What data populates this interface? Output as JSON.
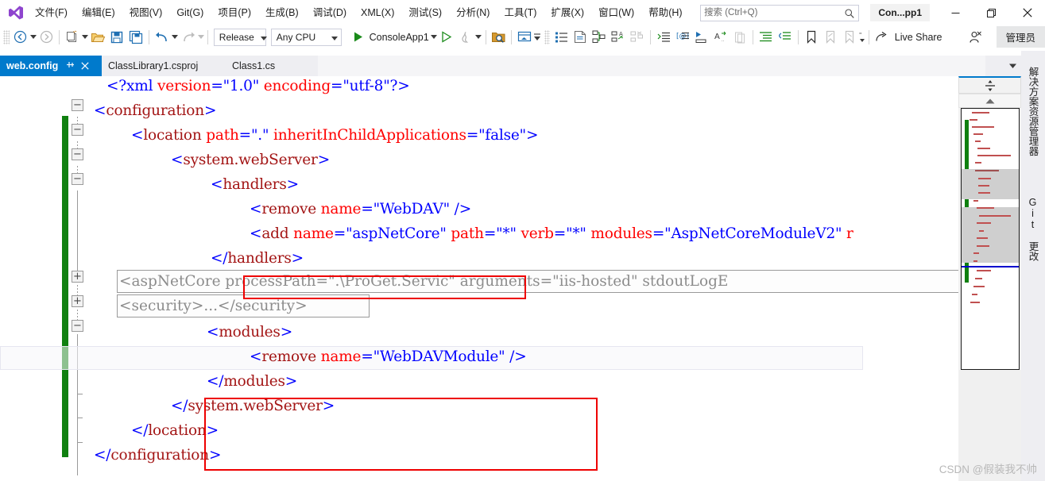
{
  "window": {
    "account_chip": "Con...pp1",
    "minimize": "─",
    "maximize": "❐",
    "close": "✕"
  },
  "menubar": {
    "logo": "vs-logo-icon",
    "items": [
      "文件(F)",
      "编辑(E)",
      "视图(V)",
      "Git(G)",
      "项目(P)",
      "生成(B)",
      "调试(D)",
      "XML(X)",
      "测试(S)",
      "分析(N)",
      "工具(T)",
      "扩展(X)",
      "窗口(W)",
      "帮助(H)"
    ]
  },
  "search": {
    "label": "搜索",
    "placeholder": "搜索 (Ctrl+Q)",
    "hint": " (Ctrl+Q)"
  },
  "toolbar": {
    "configuration": "Release",
    "platform": "Any CPU",
    "run_target": "ConsoleApp1",
    "live_share": "Live Share",
    "admin_badge": "管理员",
    "icons": [
      "navigate-back-icon",
      "navigate-forward-icon",
      "new-project-icon",
      "open-file-icon",
      "save-icon",
      "save-all-icon",
      "undo-icon",
      "redo-icon",
      "start-debug-icon",
      "start-without-debug-icon",
      "hot-reload-icon",
      "find-in-files-icon",
      "solution-explorer-icon",
      "properties-window-icon",
      "object-browser-icon",
      "class-view-icon",
      "code-definition-icon",
      "toolbox-icon",
      "indent-icon",
      "outdent-icon",
      "comment-icon",
      "uncomment-icon",
      "bookmark-icon",
      "prev-bookmark-icon",
      "next-bookmark-icon",
      "live-share-icon",
      "feedback-icon"
    ]
  },
  "tabs": {
    "items": [
      {
        "label": "web.config",
        "active": true,
        "pinned": true,
        "closable": true
      },
      {
        "label": "ClassLibrary1.csproj",
        "active": false,
        "pinned": false,
        "closable": false
      },
      {
        "label": "Class1.cs",
        "active": false,
        "pinned": false,
        "closable": false
      }
    ],
    "overflow_icon": "chevron-down-icon",
    "settings_icon": "gear-icon"
  },
  "editor": {
    "language": "xml",
    "current_line_text": "            <remove name=\"WebDAVModule\" />",
    "lines": [
      {
        "indent": 2,
        "text": "<?xml version=\"1.0\" encoding=\"utf-8\"?>"
      },
      {
        "indent": 0,
        "text": "<configuration>"
      },
      {
        "indent": 2,
        "text": "<location path=\".\" inheritInChildApplications=\"false\">"
      },
      {
        "indent": 4,
        "text": "<system.webServer>"
      },
      {
        "indent": 6,
        "text": "<handlers>"
      },
      {
        "indent": 8,
        "text": "<remove name=\"WebDAV\" />"
      },
      {
        "indent": 8,
        "text": "<add name=\"aspNetCore\" path=\"*\" verb=\"*\" modules=\"AspNetCoreModuleV2\" r"
      },
      {
        "indent": 6,
        "text": "</handlers>"
      },
      {
        "indent": 6,
        "collapsed": true,
        "text": "<aspNetCore processPath=\".\\ProGet.Servic\" arguments=\"iis-hosted\" stdoutLogE"
      },
      {
        "indent": 6,
        "collapsed": true,
        "text": "<security>...</security>"
      },
      {
        "indent": 6,
        "text": "<modules>"
      },
      {
        "indent": 8,
        "text": "<remove name=\"WebDAVModule\" />"
      },
      {
        "indent": 6,
        "text": "</modules>"
      },
      {
        "indent": 4,
        "text": "</system.webServer>"
      },
      {
        "indent": 2,
        "text": "</location>"
      },
      {
        "indent": 0,
        "text": "</configuration>"
      }
    ],
    "fold_glyphs": [
      {
        "line": 1,
        "state": "expanded",
        "symbol": "−"
      },
      {
        "line": 2,
        "state": "expanded",
        "symbol": "−"
      },
      {
        "line": 3,
        "state": "expanded",
        "symbol": "−"
      },
      {
        "line": 4,
        "state": "expanded",
        "symbol": "−"
      },
      {
        "line": 8,
        "state": "collapsed",
        "symbol": "+"
      },
      {
        "line": 9,
        "state": "collapsed",
        "symbol": "+"
      },
      {
        "line": 10,
        "state": "expanded",
        "symbol": "−"
      }
    ],
    "highlight_boxes": [
      {
        "name": "remove-webdav-highlight",
        "color": "#ee0000"
      },
      {
        "name": "modules-block-highlight",
        "color": "#ee0000"
      }
    ],
    "change_bar_color": "#108010"
  },
  "minimap": {
    "splitter_icon": "split-view-icon",
    "scroll_up_icon": "chevron-up-icon",
    "caret_color": "#0000cd",
    "change_color": "#108010",
    "selection_band_color": "#cfcfcf"
  },
  "tool_tabs": [
    {
      "label": "解决方案资源管理器"
    },
    {
      "label": "Git 更改"
    }
  ],
  "watermark": {
    "text": "CSDN @假装我不帅"
  },
  "colors": {
    "accent": "#007acc",
    "tag_name": "#a31515",
    "attribute": "#ff0000",
    "value": "#0000ff",
    "bracket": "#0000ff",
    "highlight": "#ee0000",
    "change": "#108010"
  }
}
